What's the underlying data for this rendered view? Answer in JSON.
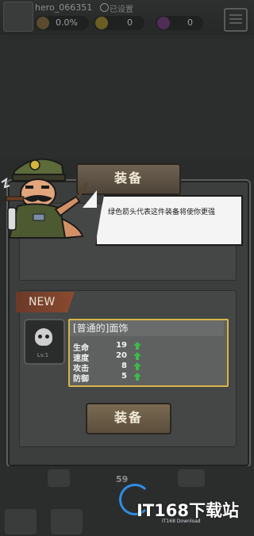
{
  "topbar": {
    "username": "hero_066351",
    "badge_text": "已设置",
    "stats": [
      {
        "icon": "percent-gem-icon",
        "value": "0.0%"
      },
      {
        "icon": "coin-icon",
        "value": "0"
      },
      {
        "icon": "gem-icon",
        "value": "0"
      }
    ]
  },
  "dialog": {
    "title": "装备",
    "tip": "绿色箭头代表这件装备将使你更强",
    "new_tag": "NEW",
    "item": {
      "level": "Lv.1",
      "name": "[普通的]面饰",
      "stats": [
        {
          "name": "生命",
          "value": "19",
          "trend": "up"
        },
        {
          "name": "速度",
          "value": "20",
          "trend": "up"
        },
        {
          "name": "攻击",
          "value": "8",
          "trend": "up"
        },
        {
          "name": "防御",
          "value": "5",
          "trend": "up"
        }
      ]
    },
    "equip_button": "装备"
  },
  "bottom": {
    "count": "59"
  },
  "watermark": {
    "brand": "IT168下载站",
    "sub": "IT168 Download"
  },
  "colors": {
    "gold_border": "#d8b44a",
    "arrow_green": "#3dbb4a",
    "watermark_blue": "#2f8de4"
  }
}
